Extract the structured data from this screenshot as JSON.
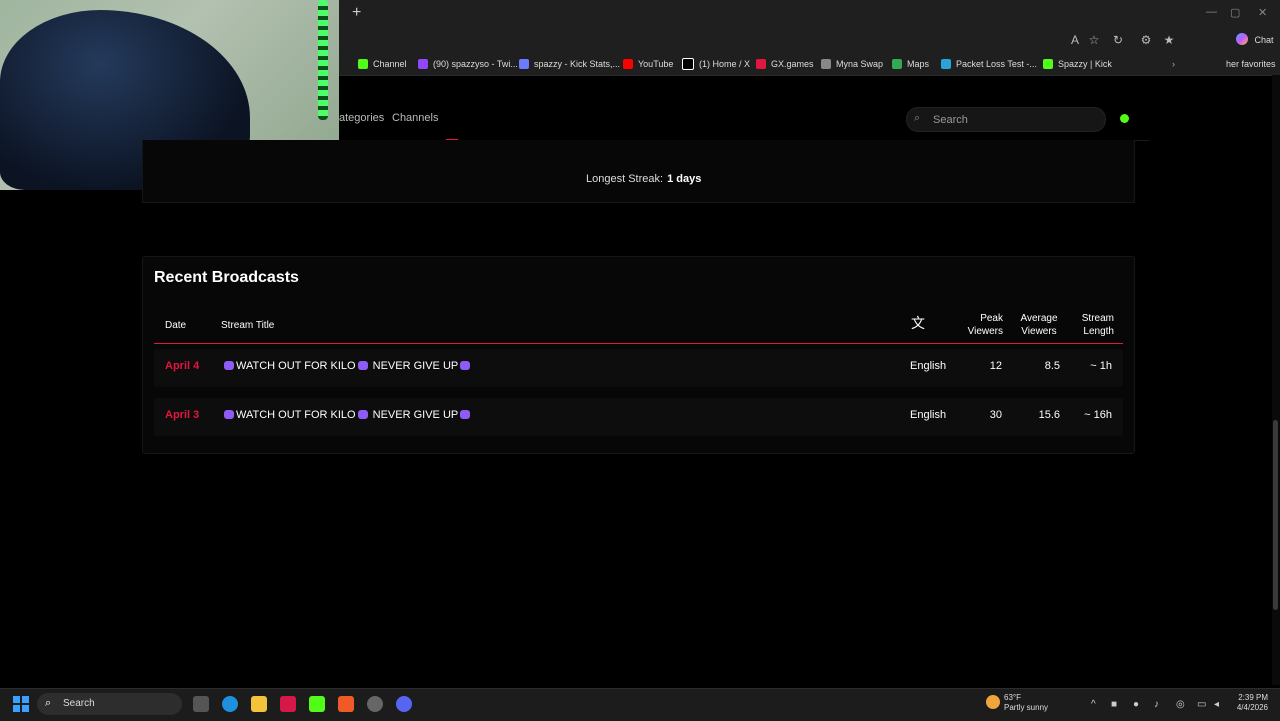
{
  "browser": {
    "new_tab": "+",
    "bookmarks": [
      {
        "label": "Channel",
        "icon": "kick-icon"
      },
      {
        "label": "(90) spazzyso - Twi...",
        "icon": "twitch-icon"
      },
      {
        "label": "spazzy - Kick Stats,...",
        "icon": "kickstats-icon"
      },
      {
        "label": "YouTube",
        "icon": "youtube-icon"
      },
      {
        "label": "(1) Home / X",
        "icon": "x-icon"
      },
      {
        "label": "GX.games",
        "icon": "gx-icon"
      },
      {
        "label": "Myna Swap",
        "icon": "myna-icon"
      },
      {
        "label": "Maps",
        "icon": "maps-icon"
      },
      {
        "label": "Packet Loss Test -...",
        "icon": "packet-icon"
      },
      {
        "label": "Spazzy | Kick",
        "icon": "kick-icon"
      }
    ],
    "other_favorites": "her favorites",
    "chat_label": "Chat"
  },
  "site": {
    "nav": {
      "categories": "ategories",
      "channels": "Channels"
    },
    "search_placeholder": "Search",
    "status_color": "#53fc18"
  },
  "streak": {
    "label": "Longest Streak:",
    "value": "1 days"
  },
  "broadcasts": {
    "title": "Recent Broadcasts",
    "headers": {
      "date": "Date",
      "title": "Stream Title",
      "peak_1": "Peak",
      "peak_2": "Viewers",
      "avg_1": "Average",
      "avg_2": "Viewers",
      "len_1": "Stream",
      "len_2": "Length"
    },
    "rows": [
      {
        "date": "April 4",
        "title_a": "WATCH OUT FOR KILO",
        "title_b": "NEVER GIVE UP",
        "language": "English",
        "peak": "12",
        "average": "8.5",
        "length": "~ 1h"
      },
      {
        "date": "April 3",
        "title_a": "WATCH OUT FOR KILO",
        "title_b": "NEVER GIVE UP",
        "language": "English",
        "peak": "30",
        "average": "15.6",
        "length": "~ 16h"
      }
    ],
    "accent_color": "#e3173d"
  },
  "taskbar": {
    "search_label": "Search",
    "weather_temp": "63°F",
    "weather_desc": "Partly sunny",
    "time": "2:39 PM",
    "date": "4/4/2026"
  }
}
